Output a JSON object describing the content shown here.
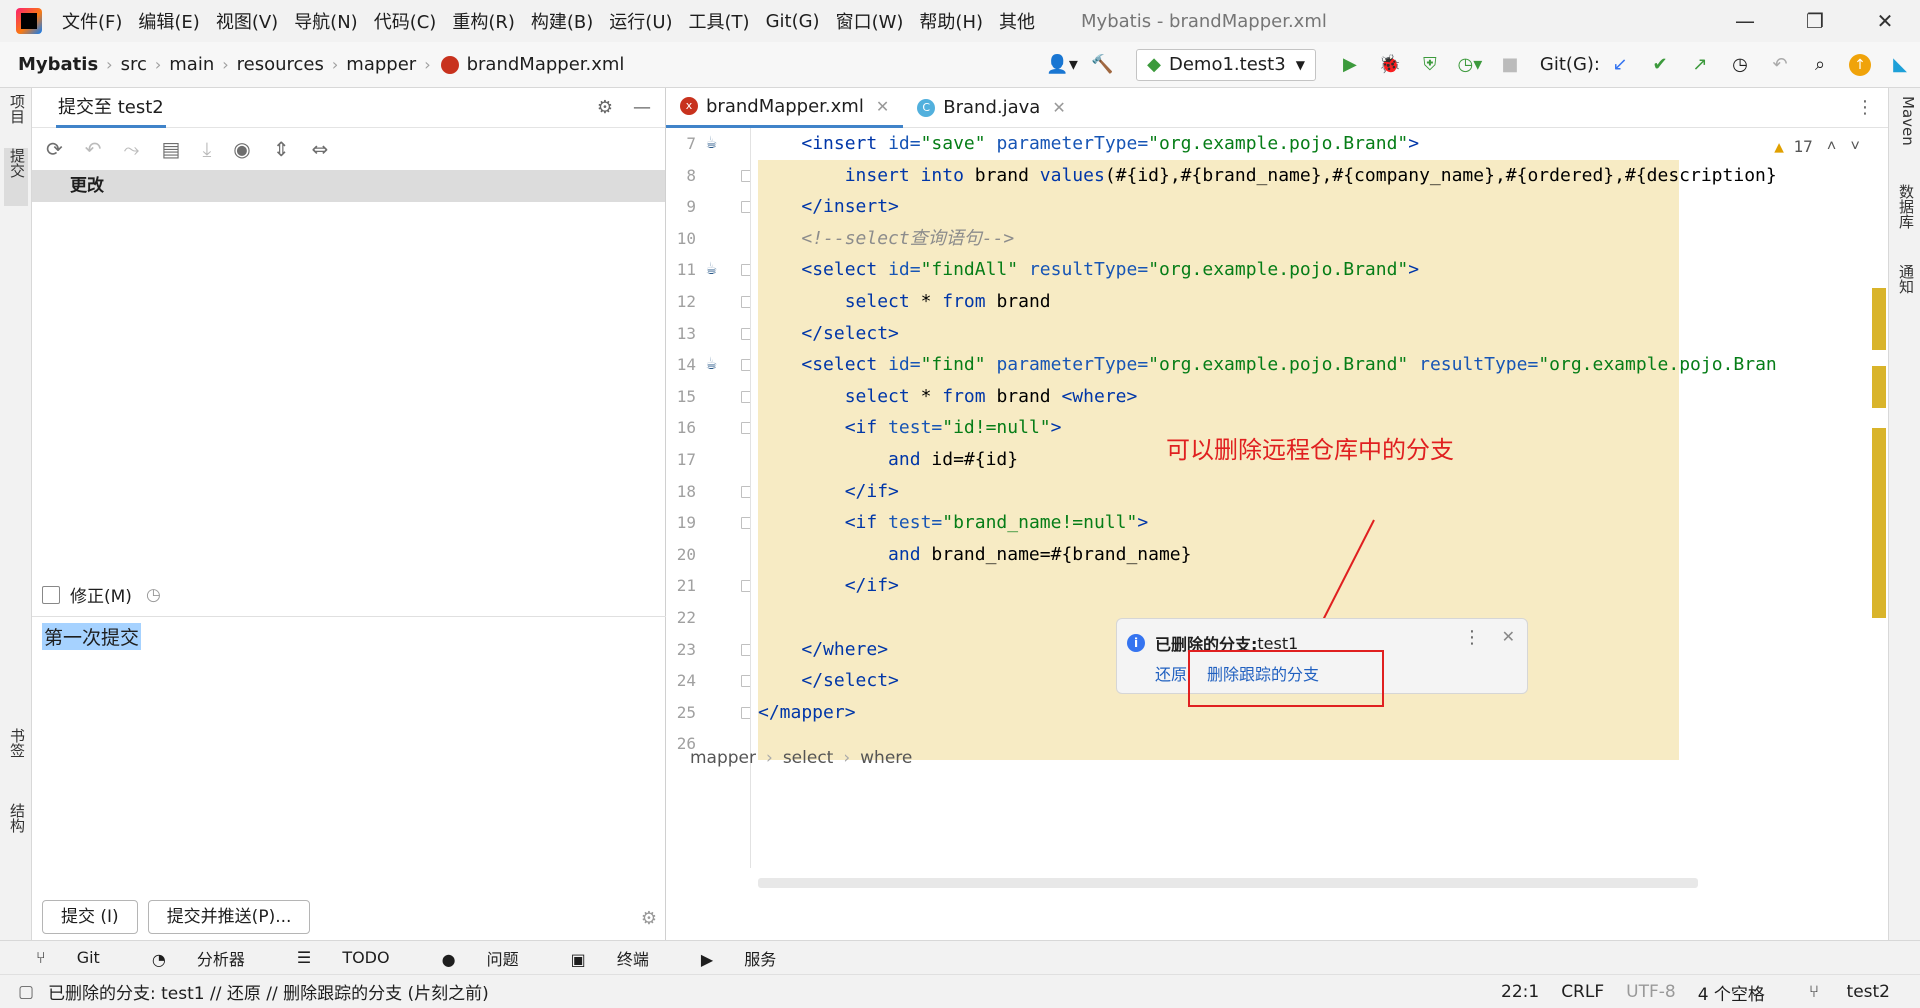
{
  "app": {
    "title": "Mybatis - brandMapper.xml"
  },
  "menu": [
    "文件(F)",
    "编辑(E)",
    "视图(V)",
    "导航(N)",
    "代码(C)",
    "重构(R)",
    "构建(B)",
    "运行(U)",
    "工具(T)",
    "Git(G)",
    "窗口(W)",
    "帮助(H)",
    "其他"
  ],
  "breadcrumb": [
    "Mybatis",
    "src",
    "main",
    "resources",
    "mapper",
    "brandMapper.xml"
  ],
  "toolbar": {
    "run_config": "Demo1.test3",
    "git_label": "Git(G):"
  },
  "left_strip": {
    "project": "项目",
    "commit": "提交",
    "bookmarks": "书签",
    "structure": "结构"
  },
  "commit_panel": {
    "tab": "提交至 test2",
    "changes_header": "更改",
    "amend_label": "修正(M)",
    "message": "第一次提交",
    "commit_button": "提交 (I)",
    "commit_push_button": "提交并推送(P)..."
  },
  "editor": {
    "tabs": [
      {
        "label": "brandMapper.xml",
        "icon_text": "x"
      },
      {
        "label": "Brand.java",
        "icon_text": "C"
      }
    ],
    "inspections": "17",
    "lines": [
      {
        "n": "7",
        "html": "    <span class='t'>&lt;insert</span> <span class='a'>id=</span><span class='s'>\"save\"</span> <span class='a'>parameterType=</span><span class='s'>\"org.example.pojo.Brand\"</span><span class='t'>&gt;</span>"
      },
      {
        "n": "8",
        "html": "        <span class='k'>insert into</span> brand <span class='k'>values</span>(#{id},#{brand_name},#{company_name},#{ordered},#{description}"
      },
      {
        "n": "9",
        "html": "    <span class='t'>&lt;/insert&gt;</span>"
      },
      {
        "n": "10",
        "html": "    <span class='c'>&lt;!--select查询语句--&gt;</span>"
      },
      {
        "n": "11",
        "html": "    <span class='t'>&lt;select</span> <span class='a'>id=</span><span class='s'>\"findAll\"</span> <span class='a'>resultType=</span><span class='s'>\"org.example.pojo.Brand\"</span><span class='t'>&gt;</span>"
      },
      {
        "n": "12",
        "html": "        <span class='k'>select</span> * <span class='k'>from</span> brand"
      },
      {
        "n": "13",
        "html": "    <span class='t'>&lt;/select&gt;</span>"
      },
      {
        "n": "14",
        "html": "    <span class='t'>&lt;select</span> <span class='a'>id=</span><span class='s'>\"find\"</span> <span class='a'>parameterType=</span><span class='s'>\"org.example.pojo.Brand\"</span> <span class='a'>resultType=</span><span class='s'>\"org.example.pojo.Bran</span>"
      },
      {
        "n": "15",
        "html": "        <span class='k'>select</span> * <span class='k'>from</span> brand <span class='t'>&lt;where&gt;</span>"
      },
      {
        "n": "16",
        "html": "        <span class='t'>&lt;if</span> <span class='a'>test=</span><span class='s'>\"id!=null\"</span><span class='t'>&gt;</span>"
      },
      {
        "n": "17",
        "html": "            <span class='k'>and</span> id=#{id}"
      },
      {
        "n": "18",
        "html": "        <span class='t'>&lt;/if&gt;</span>"
      },
      {
        "n": "19",
        "html": "        <span class='t'>&lt;if</span> <span class='a'>test=</span><span class='s'>\"brand_name!=null\"</span><span class='t'>&gt;</span>"
      },
      {
        "n": "20",
        "html": "            <span class='k'>and</span> brand_name=#{brand_name}"
      },
      {
        "n": "21",
        "html": "        <span class='t'>&lt;/if&gt;</span>"
      },
      {
        "n": "22",
        "html": ""
      },
      {
        "n": "23",
        "html": "    <span class='t'>&lt;/where&gt;</span>"
      },
      {
        "n": "24",
        "html": "    <span class='t'>&lt;/select&gt;</span>"
      },
      {
        "n": "25",
        "html": "<span class='t'>&lt;/mapper&gt;</span>"
      },
      {
        "n": "26",
        "html": ""
      }
    ],
    "breadcrumb": [
      "mapper",
      "select",
      "where"
    ]
  },
  "annotation": "可以删除远程仓库中的分支",
  "notification": {
    "title": "已删除的分支:",
    "branch": " test1",
    "restore": "还原",
    "delete_tracked": "删除跟踪的分支"
  },
  "right_strip": {
    "maven": "Maven",
    "database": "数据库",
    "notifications": "通知"
  },
  "bottom_tools": [
    "Git",
    "分析器",
    "TODO",
    "问题",
    "终端",
    "服务"
  ],
  "status": {
    "message": "已删除的分支: test1 // 还原 // 删除跟踪的分支 (片刻之前)",
    "position": "22:1",
    "line_sep": "CRLF",
    "encoding": "UTF-8",
    "indent": "4 个空格",
    "branch": "test2"
  }
}
